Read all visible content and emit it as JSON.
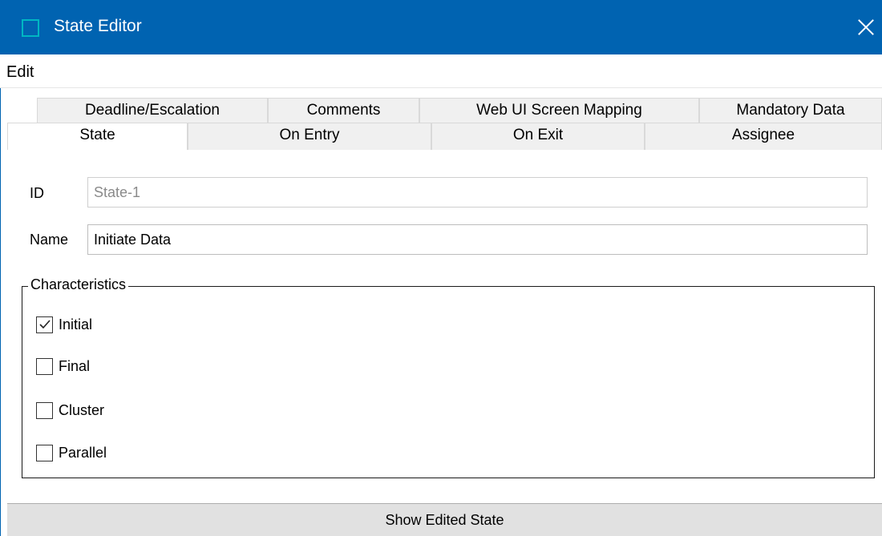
{
  "window": {
    "title": "State Editor",
    "icon": "window-app-icon",
    "accent": "#0063b1"
  },
  "menu": {
    "edit": "Edit"
  },
  "tabs": {
    "back": [
      {
        "label": "Deadline/Escalation"
      },
      {
        "label": "Comments"
      },
      {
        "label": "Web UI Screen Mapping"
      },
      {
        "label": "Mandatory Data"
      }
    ],
    "front": [
      {
        "label": "State",
        "active": true
      },
      {
        "label": "On Entry"
      },
      {
        "label": "On Exit"
      },
      {
        "label": "Assignee"
      }
    ]
  },
  "form": {
    "id_label": "ID",
    "id_value": "State-1",
    "name_label": "Name",
    "name_value": "Initiate Data"
  },
  "characteristics": {
    "title": "Characteristics",
    "options": [
      {
        "label": "Initial",
        "checked": true
      },
      {
        "label": "Final",
        "checked": false
      },
      {
        "label": "Cluster",
        "checked": false
      },
      {
        "label": "Parallel",
        "checked": false
      }
    ]
  },
  "footer": {
    "button_label": "Show Edited State"
  }
}
